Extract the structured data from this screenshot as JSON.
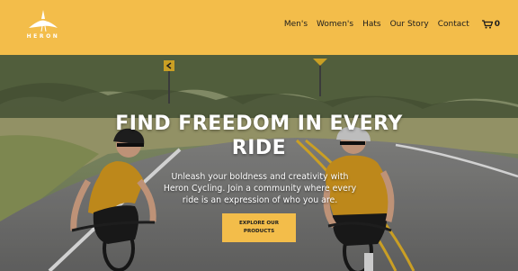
{
  "brand": {
    "name": "HERON"
  },
  "nav": {
    "links": [
      "Men's",
      "Women's",
      "Hats",
      "Our Story",
      "Contact"
    ],
    "cart_count": "0"
  },
  "hero": {
    "headline": "FIND FREEDOM IN EVERY RIDE",
    "subtext": "Unleash your boldness and creativity with Heron Cycling. Join a community where every ride is an expression of who you are.",
    "cta_label": "EXPLORE OUR PRODUCTS"
  },
  "colors": {
    "accent": "#f3bd4a",
    "text_dark": "#1d1d1d"
  }
}
